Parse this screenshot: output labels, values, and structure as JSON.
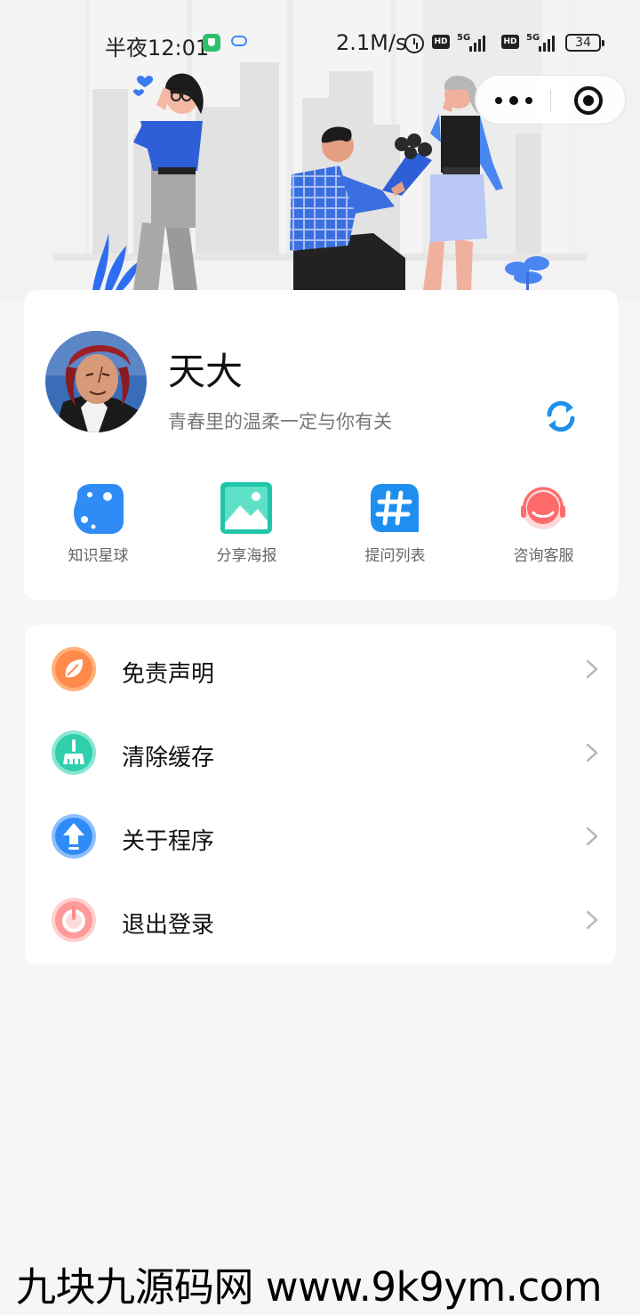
{
  "status_bar": {
    "time": "半夜12:01",
    "net_speed": "2.1M/s",
    "hd_label": "HD",
    "network_label": "5G",
    "battery": "34"
  },
  "profile": {
    "name": "天大",
    "bio": "青春里的温柔一定与你有关"
  },
  "quick_actions": [
    {
      "label": "知识星球",
      "icon": "planet-icon"
    },
    {
      "label": "分享海报",
      "icon": "poster-image-icon"
    },
    {
      "label": "提问列表",
      "icon": "hashtag-icon"
    },
    {
      "label": "咨询客服",
      "icon": "headset-icon"
    }
  ],
  "menu": [
    {
      "label": "免责声明",
      "icon": "leaf-icon"
    },
    {
      "label": "清除缓存",
      "icon": "broom-icon"
    },
    {
      "label": "关于程序",
      "icon": "upload-arrow-icon"
    },
    {
      "label": "退出登录",
      "icon": "power-icon"
    }
  ],
  "watermark": "九块九源码网 www.9k9ym.com",
  "colors": {
    "planet": "#2f8cf6",
    "poster": "#1fc5a8",
    "hashtag": "#1e8fee",
    "headset": "#ff6b6b",
    "refresh": "#1e90e8",
    "disclaimer": "#ff8a4c",
    "cache": "#2fcfae",
    "about": "#2f8cf6",
    "logout": "#ff8a8a"
  }
}
